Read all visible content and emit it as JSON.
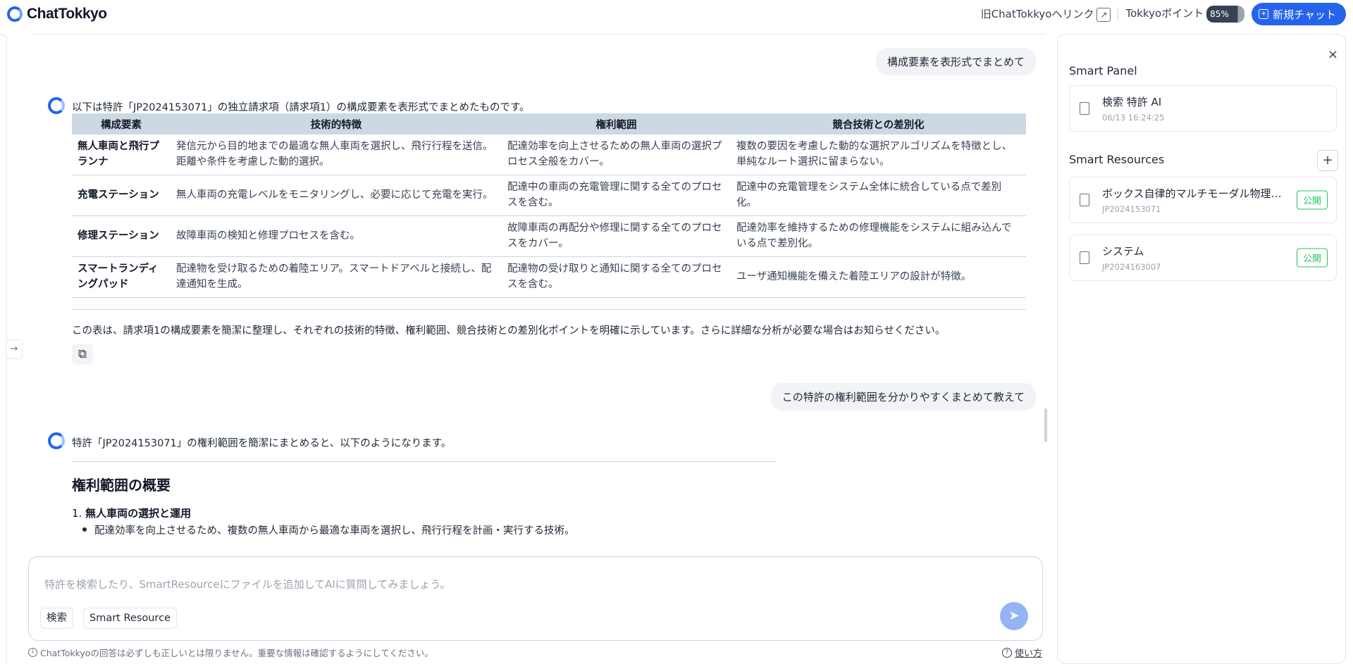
{
  "header": {
    "brand": "ChatTokkyo",
    "legacy_link": "旧ChatTokkyoへリンク",
    "points_label": "Tokkyoポイント",
    "points_value": "85%",
    "new_chat": "新規チャット"
  },
  "chat": {
    "msg1_user": "構成要素を表形式でまとめて",
    "msg1_ai_intro": "以下は特許「JP2024153071」の独立請求項（請求項1）の構成要素を表形式でまとめたものです。",
    "table": {
      "headers": [
        "構成要素",
        "技術的特徴",
        "権利範囲",
        "競合技術との差別化"
      ],
      "rows": [
        [
          "無人車両と飛行プランナ",
          "発信元から目的地までの最適な無人車両を選択し、飛行行程を送信。距離や条件を考慮した動的選択。",
          "配達効率を向上させるための無人車両の選択プロセス全般をカバー。",
          "複数の要因を考慮した動的な選択アルゴリズムを特徴とし、単純なルート選択に留まらない。"
        ],
        [
          "充電ステーション",
          "無人車両の充電レベルをモニタリングし、必要に応じて充電を実行。",
          "配達中の車両の充電管理に関する全てのプロセスを含む。",
          "配達中の充電管理をシステム全体に統合している点で差別化。"
        ],
        [
          "修理ステーション",
          "故障車両の検知と修理プロセスを含む。",
          "故障車両の再配分や修理に関する全てのプロセスをカバー。",
          "配達効率を維持するための修理機能をシステムに組み込んでいる点で差別化。"
        ],
        [
          "スマートランディングパッド",
          "配達物を受け取るための着陸エリア。スマートドアベルと接続し、配達通知を生成。",
          "配達物の受け取りと通知に関する全てのプロセスを含む。",
          "ユーザ通知機能を備えた着陸エリアの設計が特徴。"
        ]
      ]
    },
    "msg1_ai_outro": "この表は、請求項1の構成要素を簡潔に整理し、それぞれの技術的特徴、権利範囲、競合技術との差別化ポイントを明確に示しています。さらに詳細な分析が必要な場合はお知らせください。",
    "msg2_user": "この特許の権利範囲を分かりやすくまとめて教えて",
    "msg2_ai_intro": "特許「JP2024153071」の権利範囲を簡潔にまとめると、以下のようになります。",
    "section_title": "権利範囲の概要",
    "numbered_prefix": "1.",
    "numbered_item": "無人車両の選択と運用",
    "bullet_item": "配達効率を向上させるため、複数の無人車両から最適な車両を選択し、飛行行程を計画・実行する技術。"
  },
  "input": {
    "placeholder": "特許を検索したり、SmartResourceにファイルを追加してAIに質問してみましょう。",
    "chip_search": "検索",
    "chip_resource": "Smart Resource"
  },
  "footer": {
    "disclaimer": "ChatTokkyoの回答は必ずしも正しいとは限りません。重要な情報は確認するようにしてください。",
    "usage": "使い方"
  },
  "panel": {
    "smart_panel_heading": "Smart Panel",
    "panel_card_title": "検索 特許 AI",
    "panel_card_time": "06/13 16:24:25",
    "resources_heading": "Smart Resources",
    "resources": [
      {
        "title": "ボックス自律的マルチモーダル物理配達システム",
        "id": "JP2024153071",
        "badge": "公開"
      },
      {
        "title": "システム",
        "id": "JP2024163007",
        "badge": "公開"
      }
    ]
  },
  "colors": {
    "accent": "#2563eb",
    "table_header": "#cdd8e5",
    "badge_green": "#22c55e"
  }
}
